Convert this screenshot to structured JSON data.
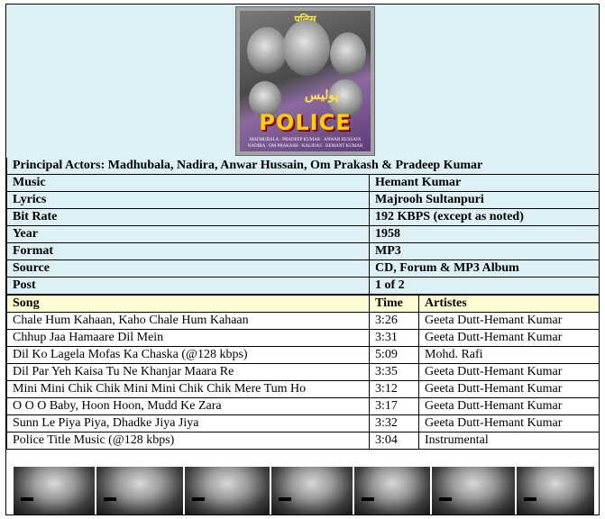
{
  "cover": {
    "title_top": "पुलिस",
    "title_urdu": "پولیس",
    "logo_text": "POLICE",
    "credits_line1": "MADHUBALA · PRADEEP KUMAR · ANWAR HUSSAIN",
    "credits_line2": "NADIRA · OM PRAKASH · KALIDAS · HEMANT KUMAR"
  },
  "principal_actors": "Principal Actors: Madhubala, Nadira, Anwar Hussain, Om Prakash & Pradeep Kumar",
  "info": [
    {
      "label": "Music",
      "value": "Hemant Kumar"
    },
    {
      "label": "Lyrics",
      "value": "Majrooh Sultanpuri"
    },
    {
      "label": "Bit Rate",
      "value": "192 KBPS (except as noted)"
    },
    {
      "label": "Year",
      "value": "1958"
    },
    {
      "label": "Format",
      "value": "MP3"
    },
    {
      "label": "Source",
      "value": "CD, Forum & MP3 Album"
    },
    {
      "label": "Post",
      "value": "1 of 2"
    }
  ],
  "songs_header": {
    "song": "Song",
    "time": "Time",
    "artistes": "Artistes"
  },
  "songs": [
    {
      "song": "Chale Hum Kahaan, Kaho Chale Hum Kahaan",
      "time": "3:26",
      "artistes": "Geeta Dutt-Hemant Kumar"
    },
    {
      "song": "Chhup Jaa Hamaare Dil Mein",
      "time": "3:31",
      "artistes": "Geeta Dutt-Hemant Kumar"
    },
    {
      "song": "Dil Ko Lagela Mofas Ka Chaska (@128 kbps)",
      "time": "5:09",
      "artistes": "Mohd. Rafi"
    },
    {
      "song": "Dil Par Yeh Kaisa Tu Ne Khanjar Maara Re",
      "time": "3:35",
      "artistes": "Geeta Dutt-Hemant Kumar"
    },
    {
      "song": "Mini Mini Chik Chik Mini Mini Chik Chik Mere Tum Ho",
      "time": "3:12",
      "artistes": "Geeta Dutt-Hemant Kumar"
    },
    {
      "song": "O O O Baby, Hoon Hoon, Mudd Ke Zara",
      "time": "3:17",
      "artistes": "Geeta Dutt-Hemant Kumar"
    },
    {
      "song": "Sunn Le Piya Piya, Dhadke Jiya Jiya",
      "time": "3:32",
      "artistes": "Geeta Dutt-Hemant Kumar"
    },
    {
      "song": "Police Title Music (@128 kbps)",
      "time": "3:04",
      "artistes": "Instrumental"
    }
  ],
  "colors": {
    "info_background": "#dcf0f6",
    "songs_header_background": "#fffbd2",
    "border": "#000000",
    "logo_yellow": "#ffd100"
  }
}
